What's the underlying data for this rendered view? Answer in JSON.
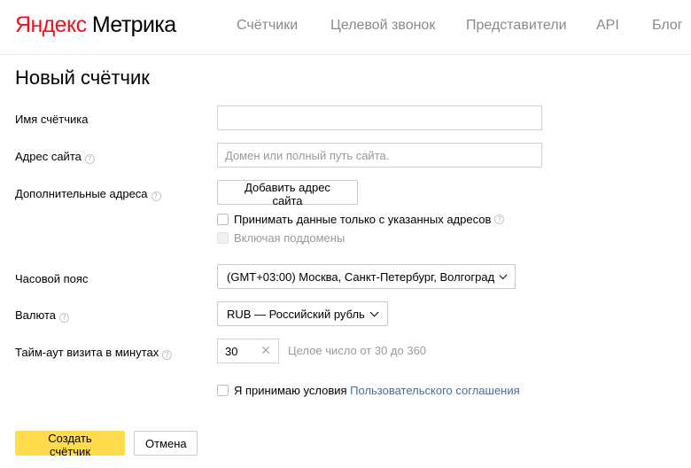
{
  "header": {
    "logo_brand": "Яндекс",
    "logo_product": "Метрика",
    "nav": [
      "Счётчики",
      "Целевой звонок",
      "Представители",
      "API",
      "Блог"
    ]
  },
  "page_title": "Новый счётчик",
  "form": {
    "name_label": "Имя счётчика",
    "name_value": "",
    "site_label": "Адрес сайта",
    "site_placeholder": "Домен или полный путь сайта.",
    "extra_label": "Дополнительные адреса",
    "add_site_button": "Добавить адрес сайта",
    "only_listed_label": "Принимать данные только с указанных адресов",
    "subdomains_label": "Включая поддомены",
    "timezone_label": "Часовой пояс",
    "timezone_value": "(GMT+03:00) Москва, Санкт-Петербург, Волгоград",
    "currency_label": "Валюта",
    "currency_value": "RUB — Российский рубль",
    "timeout_label": "Тайм-аут визита в минутах",
    "timeout_value": "30",
    "timeout_hint": "Целое число от 30 до 360",
    "agree_text": "Я принимаю условия",
    "agree_link": "Пользовательского соглашения",
    "help_glyph": "?",
    "clear_glyph": "✕"
  },
  "actions": {
    "create": "Создать счётчик",
    "cancel": "Отмена"
  },
  "colors": {
    "brand_red": "#fc0d1b",
    "primary_yellow": "#ffdb4d",
    "link": "#4d6c93"
  }
}
